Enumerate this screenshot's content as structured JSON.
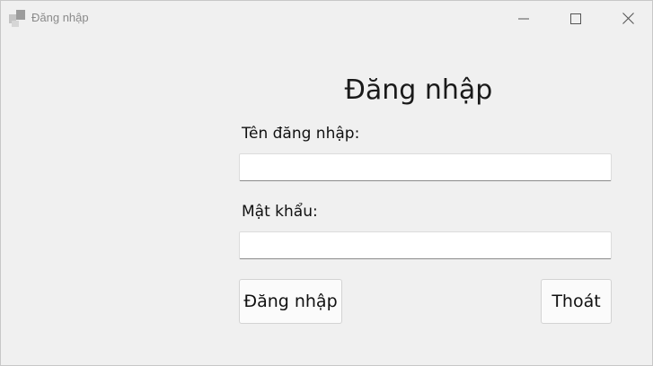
{
  "window": {
    "title": "Đăng nhập",
    "icon": "app-icon",
    "controls": [
      "minimize-icon",
      "maximize-icon",
      "close-icon"
    ]
  },
  "form": {
    "heading": "Đăng nhập",
    "username_label": "Tên đăng nhập:",
    "username_value": "",
    "password_label": "Mật khẩu:",
    "password_value": "",
    "login_button": "Đăng nhập",
    "exit_button": "Thoát"
  },
  "colors": {
    "background": "#f0f0f0",
    "title_text": "#8a8a8a",
    "field_bg": "#ffffff",
    "button_bg": "#fbfbfb"
  }
}
